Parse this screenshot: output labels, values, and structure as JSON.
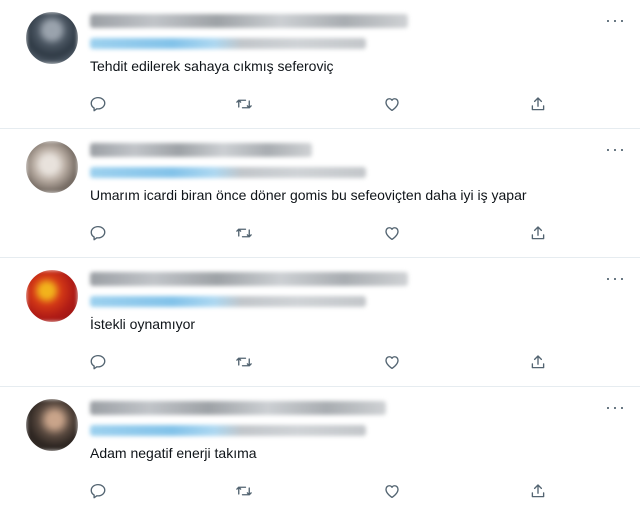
{
  "colors": {
    "icon": "#536471",
    "text": "#0f1419",
    "divider": "#e6ecf0",
    "handle_blue": "#6db8e6"
  },
  "icons": [
    "reply-icon",
    "retweet-icon",
    "like-icon",
    "share-icon",
    "more-icon"
  ],
  "tweets": [
    {
      "text": "Tehdit edilerek sahaya cıkmış seferoviç",
      "more": "···"
    },
    {
      "text": "Umarım icardi biran önce döner gomis bu sefeoviçten daha iyi iş yapar",
      "more": "···"
    },
    {
      "text": "İstekli oynamıyor",
      "more": "···"
    },
    {
      "text": "Adam negatif enerji takıma",
      "more": "···"
    }
  ]
}
